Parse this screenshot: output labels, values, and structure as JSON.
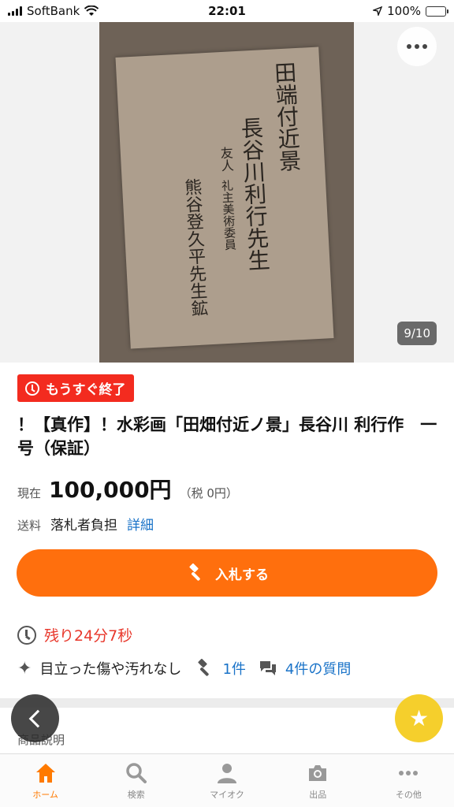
{
  "status_bar": {
    "carrier": "SoftBank",
    "time": "22:01",
    "battery_percent": "100%",
    "battery_level": 1.0
  },
  "image": {
    "counter": "9/10",
    "paper_lines": [
      "田端付近景",
      "長谷川利行先生",
      "友人",
      "礼主美術委員",
      "熊谷登久平先生鉱"
    ]
  },
  "listing": {
    "badge": "もうすぐ終了",
    "title": "！【真作】！水彩画「田畑付近ノ景」長谷川 利行作　一号（保証）",
    "price_label": "現在",
    "price": "100,000円",
    "tax": "（税 0円）",
    "shipping_label": "送料",
    "shipping_value": "落札者負担",
    "shipping_link": "詳細",
    "bid_button": "入札する",
    "remaining": "残り24分7秒",
    "condition": "目立った傷や汚れなし",
    "bids": "1件",
    "questions": "4件の質問",
    "section_label": "商品説明"
  },
  "tabs": [
    {
      "label": "ホーム",
      "icon": "home-icon",
      "active": true
    },
    {
      "label": "検索",
      "icon": "search-icon",
      "active": false
    },
    {
      "label": "マイオク",
      "icon": "person-icon",
      "active": false
    },
    {
      "label": "出品",
      "icon": "camera-icon",
      "active": false
    },
    {
      "label": "その他",
      "icon": "more-icon",
      "active": false
    }
  ],
  "colors": {
    "accent": "#ff6f0d",
    "badge": "#f32b1f",
    "link": "#1a73c8",
    "favorite": "#f5cf2c"
  }
}
